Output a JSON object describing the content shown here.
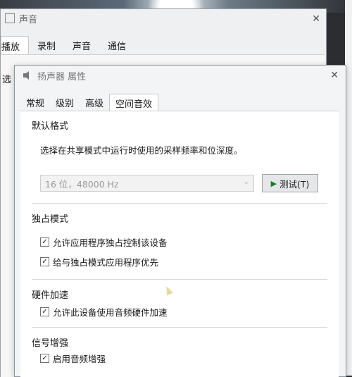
{
  "back_dialog": {
    "title": "声音",
    "tabs": [
      "播放",
      "录制",
      "声音",
      "通信"
    ],
    "select_label": "选"
  },
  "front_dialog": {
    "title": "扬声器 属性",
    "tabs": [
      "常规",
      "级别",
      "高级",
      "空间音效"
    ],
    "active_tab_index": 3,
    "default_format": {
      "section_title": "默认格式",
      "description": "选择在共享模式中运行时使用的采样频率和位深度。",
      "selected_format": "16 位，48000 Hz",
      "test_button": "测试(T)"
    },
    "exclusive_mode": {
      "section_title": "独占模式",
      "options": [
        {
          "label": "允许应用程序独占控制该设备",
          "checked": true
        },
        {
          "label": "给与独占模式应用程序优先",
          "checked": true
        }
      ]
    },
    "hardware_accel": {
      "section_title": "硬件加速",
      "options": [
        {
          "label": "允许此设备使用音频硬件加速",
          "checked": true
        }
      ]
    },
    "signal_enhance": {
      "section_title": "信号增强",
      "options": [
        {
          "label": "启用音频增强",
          "checked": true
        }
      ]
    }
  },
  "icons": {
    "close": "close-icon",
    "speaker": "speaker-icon",
    "chevron": "chevron-down-icon",
    "play": "play-icon",
    "check": "checkmark-icon"
  },
  "colors": {
    "play_green": "#1c7c2c",
    "dialog_bg": "#ffffff",
    "disabled_text": "#9a9a9a"
  }
}
